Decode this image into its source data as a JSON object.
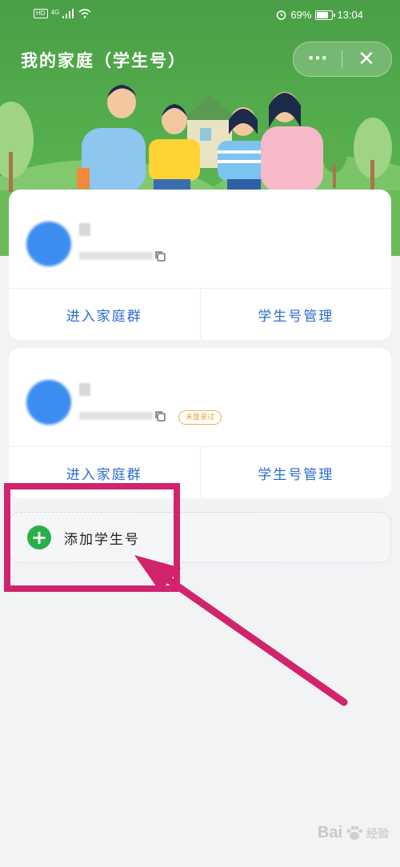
{
  "status_bar": {
    "hd": "HD",
    "network": "4G",
    "battery_percent": "69%",
    "battery_level": 0.69,
    "time": "13:04"
  },
  "header": {
    "title": "我的家庭（学生号）",
    "more_label": "···",
    "close_label": "✕"
  },
  "cards": [
    {
      "actions": [
        "进入家庭群",
        "学生号管理"
      ]
    },
    {
      "badge": "未登录过",
      "actions": [
        "进入家庭群",
        "学生号管理"
      ]
    }
  ],
  "add_student": {
    "label": "添加学生号"
  },
  "watermark": {
    "brand": "Bai",
    "sub": "经验"
  },
  "colors": {
    "header_green": "#56b04e",
    "link_blue": "#2a6bd0",
    "add_green": "#2ab04a",
    "annotation": "#d2236d",
    "badge_orange": "#e6a23c"
  },
  "icons": [
    "signal-icon",
    "wifi-icon",
    "alarm-icon",
    "battery-icon",
    "copy-icon",
    "plus-icon",
    "paw-icon"
  ]
}
